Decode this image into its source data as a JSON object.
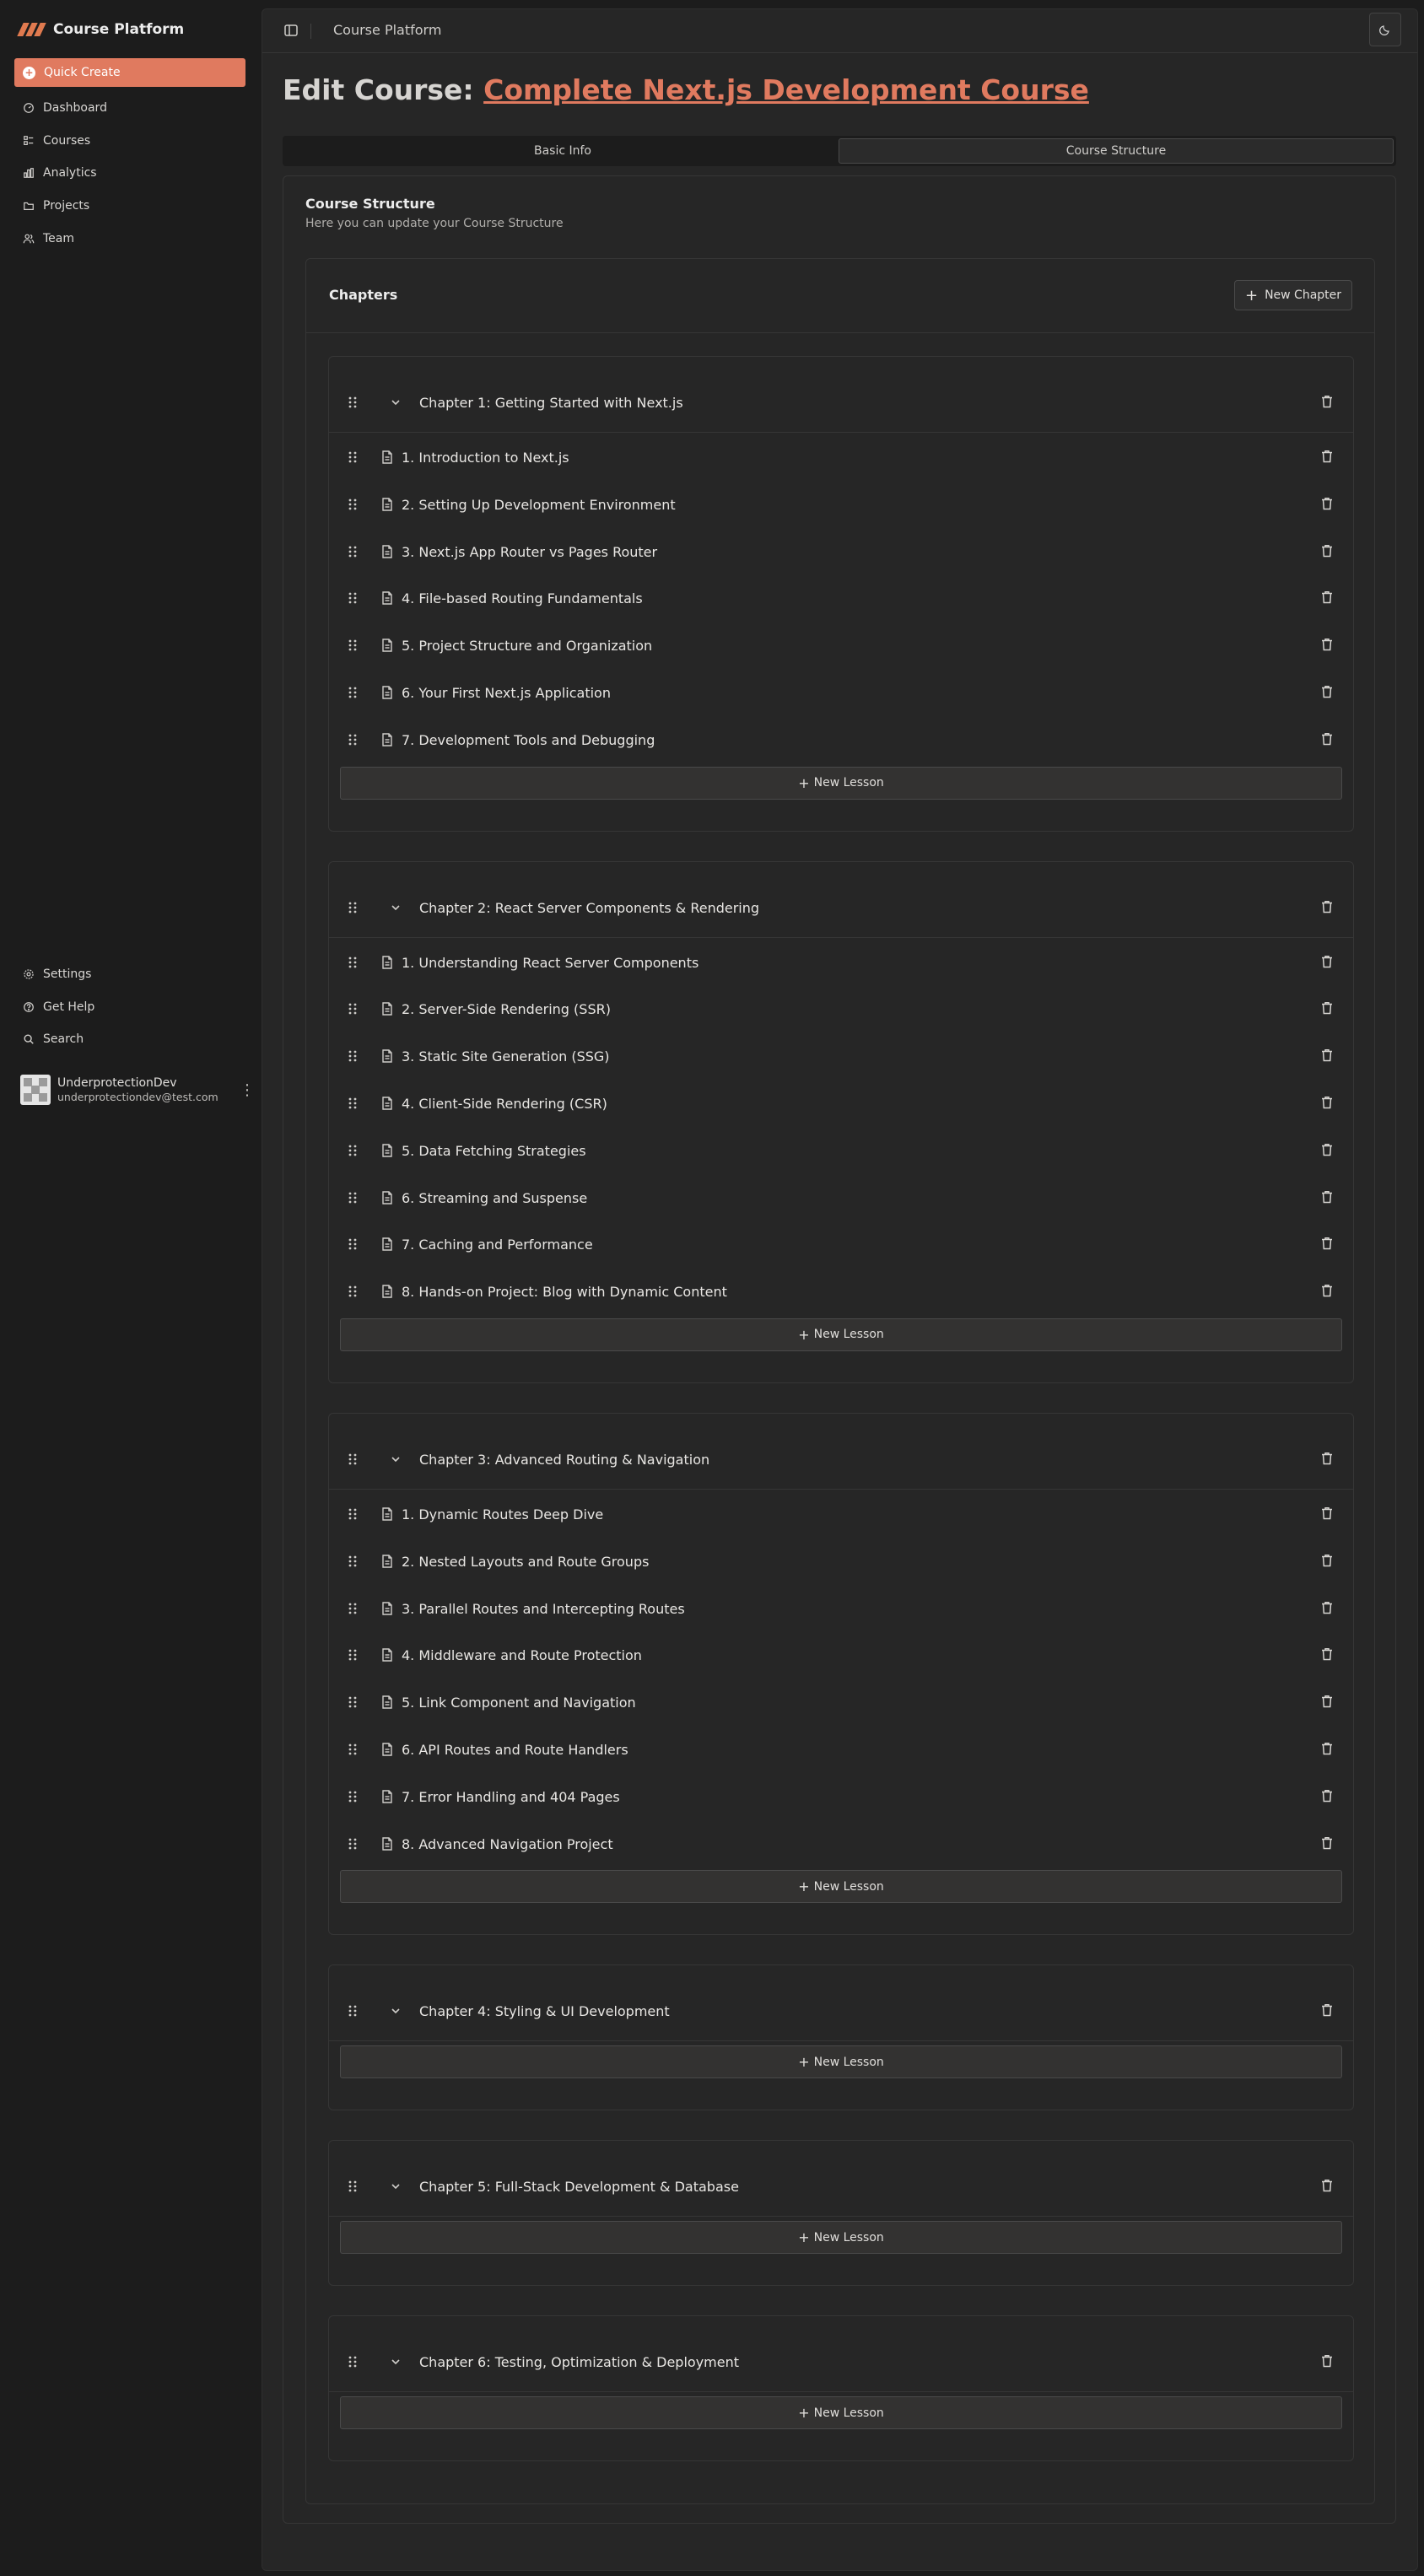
{
  "app": {
    "brand": "Course Platform",
    "accent": "#e07a5f"
  },
  "sidebar": {
    "quick_create": "Quick Create",
    "nav": [
      {
        "label": "Dashboard",
        "icon": "dashboard-icon"
      },
      {
        "label": "Courses",
        "icon": "courses-icon"
      },
      {
        "label": "Analytics",
        "icon": "analytics-icon"
      },
      {
        "label": "Projects",
        "icon": "folder-icon"
      },
      {
        "label": "Team",
        "icon": "team-icon"
      }
    ],
    "secondary": [
      {
        "label": "Settings",
        "icon": "settings-icon"
      },
      {
        "label": "Get Help",
        "icon": "help-icon"
      },
      {
        "label": "Search",
        "icon": "search-icon"
      }
    ],
    "user": {
      "name": "UnderprotectionDev",
      "email": "underprotectiondev@test.com"
    }
  },
  "header": {
    "title": "Course Platform"
  },
  "page": {
    "title_prefix": "Edit Course:",
    "course_name": "Complete Next.js Development Course",
    "tabs": [
      "Basic Info",
      "Course Structure"
    ],
    "active_tab": "Course Structure"
  },
  "structure": {
    "title": "Course Structure",
    "description": "Here you can update your Course Structure",
    "chapters_label": "Chapters",
    "new_chapter_label": "New Chapter",
    "new_lesson_label": "New Lesson",
    "chapters": [
      {
        "title": "Chapter 1: Getting Started with Next.js",
        "lessons": [
          "1. Introduction to Next.js",
          "2. Setting Up Development Environment",
          "3. Next.js App Router vs Pages Router",
          "4. File-based Routing Fundamentals",
          "5. Project Structure and Organization",
          "6. Your First Next.js Application",
          "7. Development Tools and Debugging"
        ]
      },
      {
        "title": "Chapter 2: React Server Components & Rendering",
        "lessons": [
          "1. Understanding React Server Components",
          "2. Server-Side Rendering (SSR)",
          "3. Static Site Generation (SSG)",
          "4. Client-Side Rendering (CSR)",
          "5. Data Fetching Strategies",
          "6. Streaming and Suspense",
          "7. Caching and Performance",
          "8. Hands-on Project: Blog with Dynamic Content"
        ]
      },
      {
        "title": "Chapter 3: Advanced Routing & Navigation",
        "lessons": [
          "1. Dynamic Routes Deep Dive",
          "2. Nested Layouts and Route Groups",
          "3. Parallel Routes and Intercepting Routes",
          "4. Middleware and Route Protection",
          "5. Link Component and Navigation",
          "6. API Routes and Route Handlers",
          "7. Error Handling and 404 Pages",
          "8. Advanced Navigation Project"
        ]
      },
      {
        "title": "Chapter 4: Styling & UI Development",
        "lessons": []
      },
      {
        "title": "Chapter 5: Full-Stack Development & Database",
        "lessons": []
      },
      {
        "title": "Chapter 6: Testing, Optimization & Deployment",
        "lessons": []
      }
    ]
  }
}
